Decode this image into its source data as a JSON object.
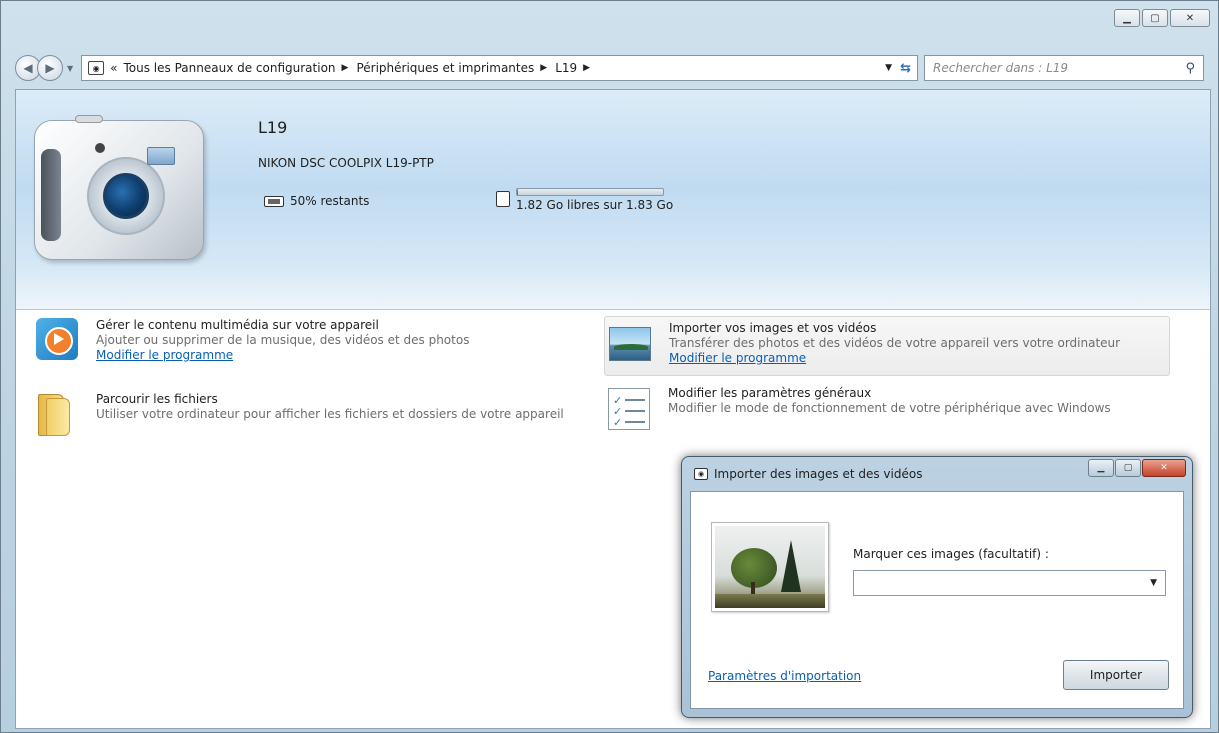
{
  "window": {
    "minimize": "▁",
    "maximize": "▢",
    "close": "✕"
  },
  "address": {
    "icon": "camera-icon",
    "crumb_prefix": "«",
    "crumbs": [
      "Tous les Panneaux de configuration",
      "Périphériques et imprimantes",
      "L19"
    ],
    "refresh_icon": "refresh-icon",
    "search_placeholder": "Rechercher dans : L19"
  },
  "device": {
    "name": "L19",
    "model": "NIKON DSC COOLPIX L19-PTP",
    "battery": "50% restants",
    "storage_text": "1.82 Go libres sur 1.83 Go",
    "storage_used_fraction": 0.01
  },
  "tasks": [
    {
      "title": "Gérer le contenu multimédia sur votre appareil",
      "description": "Ajouter ou supprimer de la musique, des vidéos et des photos",
      "link": "Modifier le programme"
    },
    {
      "title": "Importer vos images et vos vidéos",
      "description": "Transférer des photos et des vidéos de votre appareil vers votre ordinateur",
      "link": "Modifier le programme"
    },
    {
      "title": "Parcourir les fichiers",
      "description": "Utiliser votre ordinateur pour afficher les fichiers et dossiers de votre appareil"
    },
    {
      "title": "Modifier les paramètres généraux",
      "description": "Modifier le mode de fonctionnement de votre périphérique avec Windows"
    }
  ],
  "dialog": {
    "title": "Importer des images et des vidéos",
    "tag_label": "Marquer ces images (facultatif) :",
    "tag_value": "",
    "settings_link": "Paramètres d'importation",
    "import_button": "Importer"
  }
}
